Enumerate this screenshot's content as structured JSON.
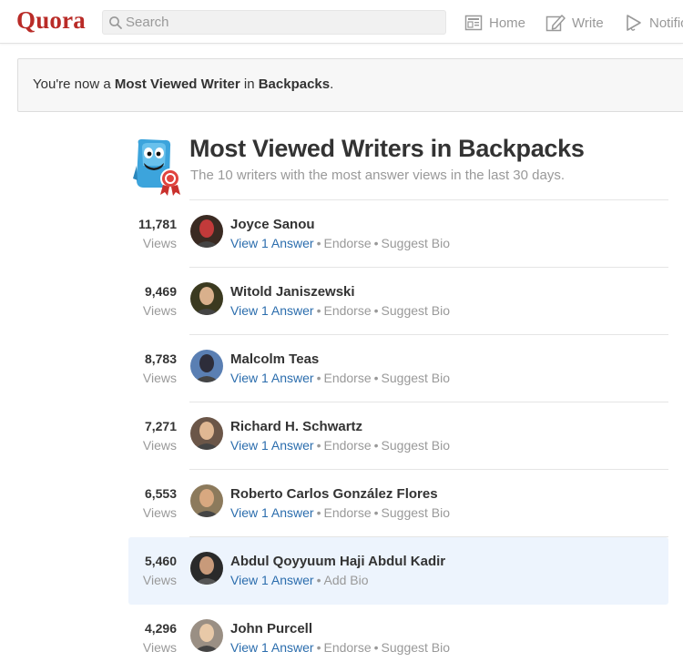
{
  "header": {
    "logo": "Quora",
    "search_placeholder": "Search",
    "nav": {
      "home": "Home",
      "write": "Write",
      "notifications": "Notific"
    }
  },
  "banner": {
    "prefix": "You're now a ",
    "rank": "Most Viewed Writer",
    "middle": " in ",
    "topic": "Backpacks",
    "suffix": "."
  },
  "page": {
    "title": "Most Viewed Writers in Backpacks",
    "subtitle": "The 10 writers with the most answer views in the last 30 days."
  },
  "labels": {
    "views": "Views",
    "view_answer": "View 1 Answer",
    "endorse": "Endorse",
    "suggest_bio": "Suggest Bio",
    "add_bio": "Add Bio",
    "separator": "•"
  },
  "writers": [
    {
      "count": "11,781",
      "name": "Joyce Sanou",
      "avatar_bg": "#3a2a22",
      "avatar_fg": "#c23a3a"
    },
    {
      "count": "9,469",
      "name": "Witold Janiszewski",
      "avatar_bg": "#3b3a20",
      "avatar_fg": "#d9b08c"
    },
    {
      "count": "8,783",
      "name": "Malcolm Teas",
      "avatar_bg": "#5a7fb3",
      "avatar_fg": "#2d2d3a"
    },
    {
      "count": "7,271",
      "name": "Richard H. Schwartz",
      "avatar_bg": "#6b5648",
      "avatar_fg": "#e0b893"
    },
    {
      "count": "6,553",
      "name": "Roberto Carlos González Flores",
      "avatar_bg": "#8c7a5c",
      "avatar_fg": "#d8a880"
    },
    {
      "count": "5,460",
      "name": "Abdul Qoyyuum Haji Abdul Kadir",
      "avatar_bg": "#2a2a2a",
      "avatar_fg": "#c89a7a",
      "own": true
    },
    {
      "count": "4,296",
      "name": "John Purcell",
      "avatar_bg": "#9a8f84",
      "avatar_fg": "#e8c9a8"
    }
  ],
  "colors": {
    "brand": "#b92b27",
    "link": "#2b6dad",
    "muted": "#999999",
    "highlight": "#edf4fd"
  }
}
